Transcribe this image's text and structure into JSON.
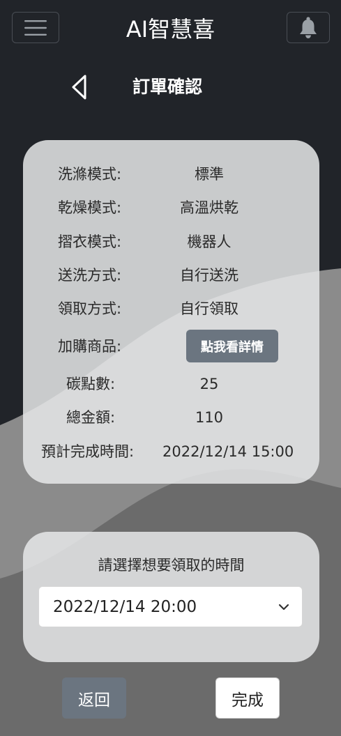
{
  "header": {
    "title": "AI智慧喜",
    "menu_icon": "hamburger-menu-icon",
    "bell_icon": "bell-icon"
  },
  "page": {
    "title": "訂單確認",
    "back_icon": "chevron-left-icon"
  },
  "order": {
    "rows": [
      {
        "label": "洗滌模式:",
        "value": "標準"
      },
      {
        "label": "乾燥模式:",
        "value": "高溫烘乾"
      },
      {
        "label": "摺衣模式:",
        "value": "機器人"
      },
      {
        "label": "送洗方式:",
        "value": "自行送洗"
      },
      {
        "label": "領取方式:",
        "value": "自行領取"
      },
      {
        "label": "加購商品:",
        "value": "點我看詳情"
      },
      {
        "label": "碳點數:",
        "value": "25"
      },
      {
        "label": "總金額:",
        "value": "110"
      },
      {
        "label": "預計完成時間:",
        "value": "2022/12/14 15:00"
      }
    ]
  },
  "pickup": {
    "prompt": "請選擇想要領取的時間",
    "selected_time": "2022/12/14 20:00",
    "dropdown_icon": "chevron-down-icon"
  },
  "actions": {
    "back_label": "返回",
    "done_label": "完成"
  },
  "colors": {
    "background": "#212429",
    "card": "#e5e6e8",
    "button_gray": "#6b7580",
    "text_light": "#ffffff"
  }
}
